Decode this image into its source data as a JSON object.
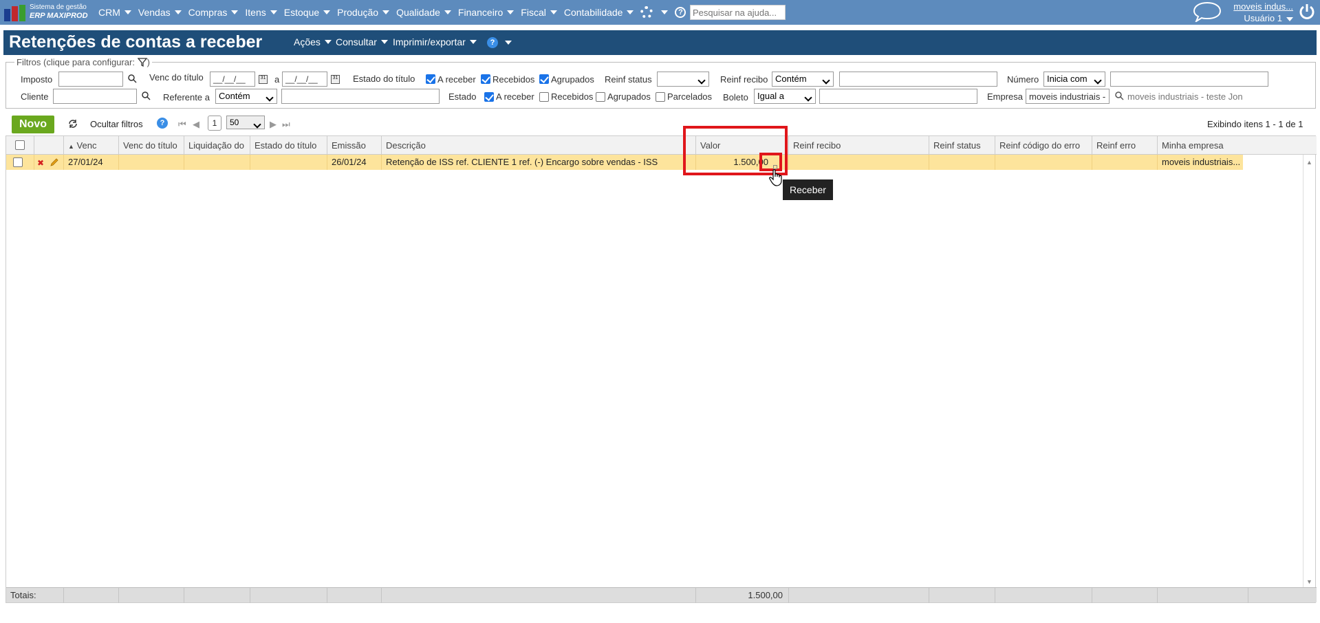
{
  "app": {
    "logo_line1": "Sistema de gestão",
    "logo_line2": "ERP MAXIPROD"
  },
  "menu": [
    "CRM",
    "Vendas",
    "Compras",
    "Itens",
    "Estoque",
    "Produção",
    "Qualidade",
    "Financeiro",
    "Fiscal",
    "Contabilidade"
  ],
  "search": {
    "placeholder": "Pesquisar na ajuda..."
  },
  "user": {
    "company": "moveis indus...",
    "name": "Usuário 1"
  },
  "page": {
    "title": "Retenções de contas a receber",
    "actions": [
      "Ações",
      "Consultar",
      "Imprimir/exportar"
    ]
  },
  "filters": {
    "legend": "Filtros (clique para configurar:",
    "imposto": "Imposto",
    "venc": "Venc do título",
    "date_from": "__/__/__",
    "date_to": "__/__/__",
    "a": "a",
    "estado_titulo": "Estado do título",
    "a_receber": "A receber",
    "recebidos": "Recebidos",
    "agrupados": "Agrupados",
    "reinf_status": "Reinf status",
    "reinf_recibo": "Reinf recibo",
    "reinf_recibo_op": "Contém",
    "numero": "Número",
    "numero_op": "Inicia com",
    "cliente": "Cliente",
    "referente": "Referente a",
    "referente_op": "Contém",
    "estado": "Estado",
    "e_a_receber": "A receber",
    "e_recebidos": "Recebidos",
    "e_agrupados": "Agrupados",
    "e_parcelados": "Parcelados",
    "boleto": "Boleto",
    "boleto_op": "Igual a",
    "empresa": "Empresa",
    "empresa_val": "moveis industriais -",
    "empresa_text": "moveis industriais - teste Jon"
  },
  "toolbar": {
    "novo": "Novo",
    "ocultar": "Ocultar filtros",
    "page": "1",
    "per_page": "50",
    "showing": "Exibindo itens 1 - 1 de 1"
  },
  "columns": [
    "Venc",
    "Venc do título",
    "Liquidação do",
    "Estado do título",
    "Emissão",
    "Descrição",
    "Valor",
    "Reinf recibo",
    "Reinf status",
    "Reinf código do erro",
    "Reinf erro",
    "Minha empresa"
  ],
  "row": {
    "venc": "27/01/24",
    "emissao": "26/01/24",
    "descricao": "Retenção de ISS ref. CLIENTE 1 ref. (-) Encargo sobre vendas - ISS",
    "valor": "1.500,00",
    "empresa": "moveis industriais..."
  },
  "totals": {
    "label": "Totais:",
    "valor": "1.500,00"
  },
  "tooltip": "Receber",
  "colors": {
    "nav": "#5d8bbd",
    "title": "#1f4e79",
    "row": "#fde49c",
    "novo": "#6aa81e",
    "highlight": "#e0161b"
  }
}
